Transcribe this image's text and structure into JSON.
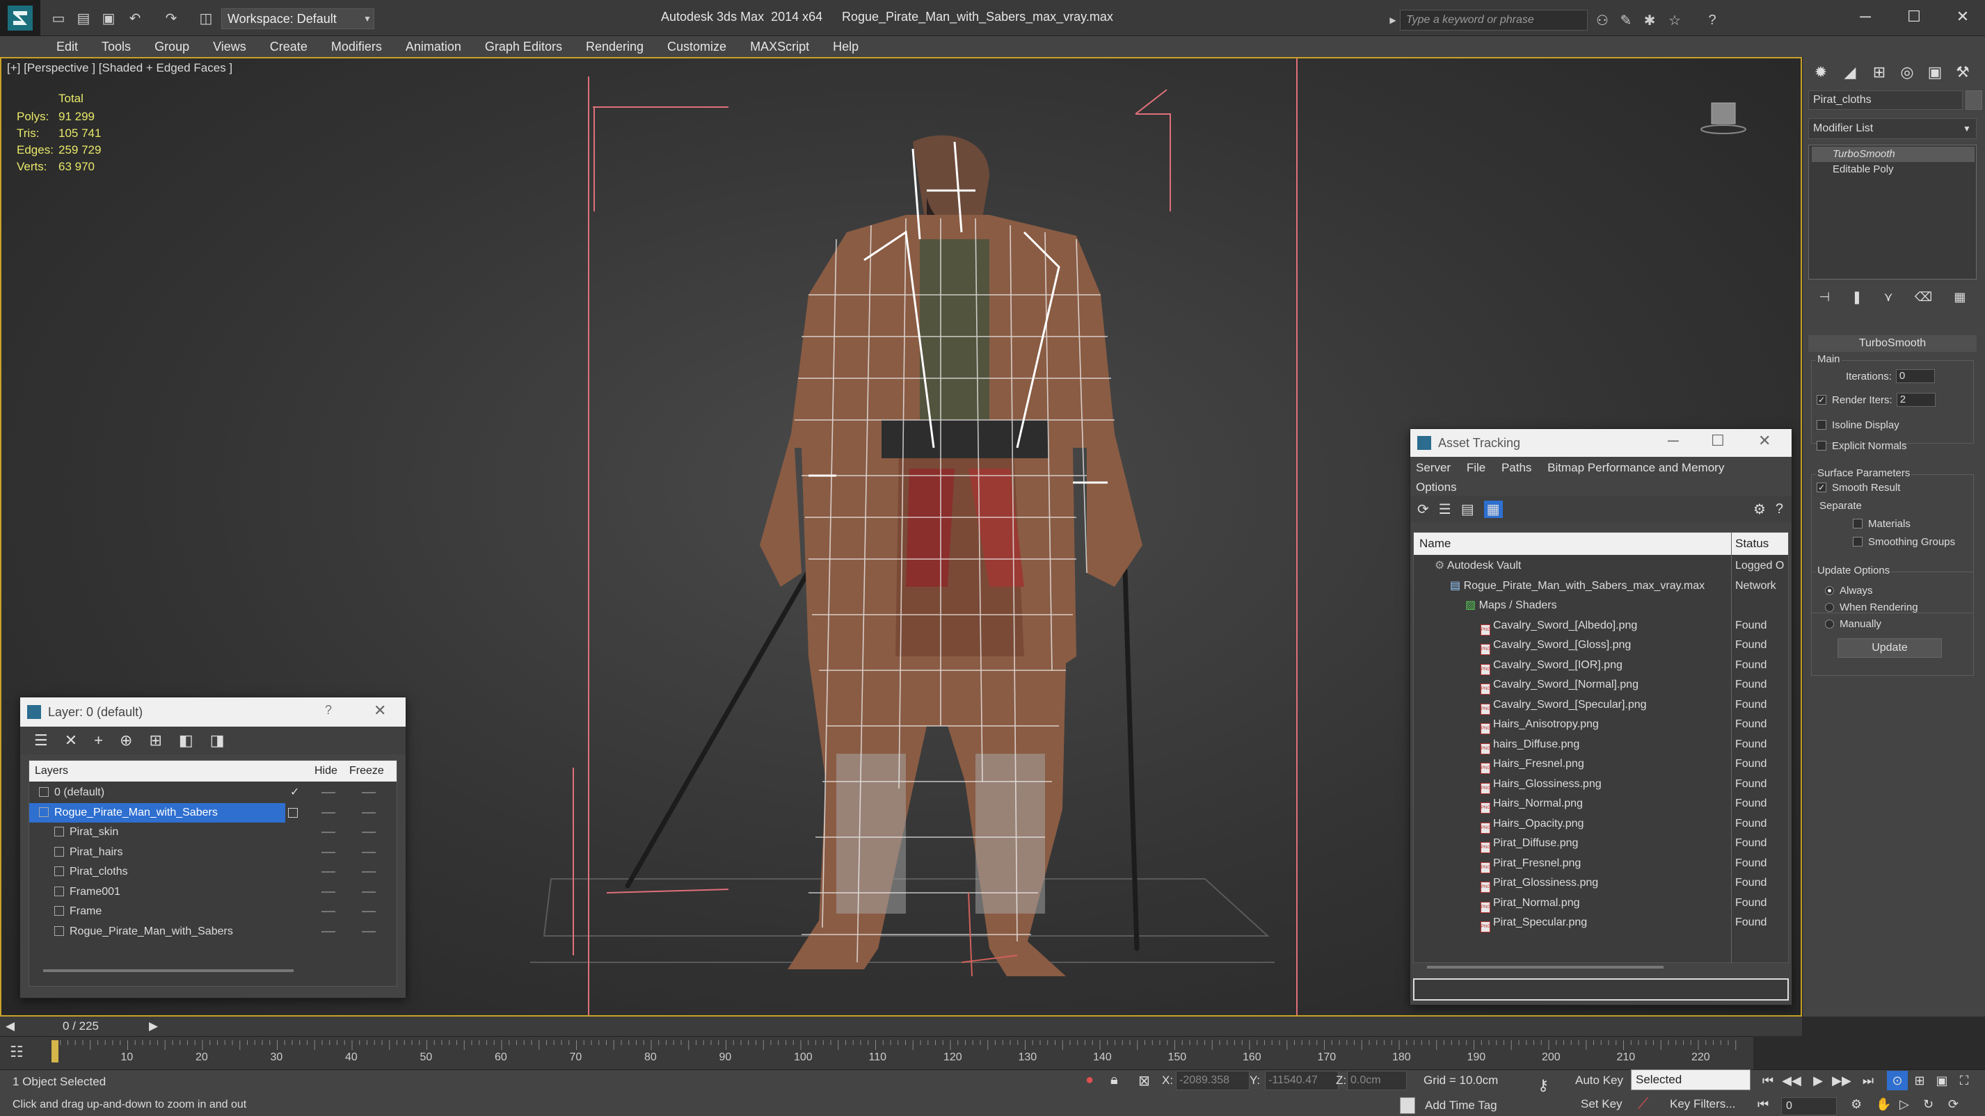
{
  "titlebar": {
    "workspace": "Workspace: Default",
    "app_title": "Autodesk 3ds Max  2014 x64",
    "file_title": "Rogue_Pirate_Man_with_Sabers_max_vray.max",
    "search_placeholder": "Type a keyword or phrase"
  },
  "menu": [
    "Edit",
    "Tools",
    "Group",
    "Views",
    "Create",
    "Modifiers",
    "Animation",
    "Graph Editors",
    "Rendering",
    "Customize",
    "MAXScript",
    "Help"
  ],
  "viewport": {
    "label": "[+] [Perspective ] [Shaded + Edged Faces ]",
    "stats_header": "Total",
    "stats": [
      {
        "label": "Polys:",
        "value": "91 299"
      },
      {
        "label": "Tris:",
        "value": "105 741"
      },
      {
        "label": "Edges:",
        "value": "259 729"
      },
      {
        "label": "Verts:",
        "value": "63 970"
      }
    ]
  },
  "command_panel": {
    "object_name": "Pirat_cloths",
    "modifier_list": "Modifier List",
    "stack": [
      "TurboSmooth",
      "Editable Poly"
    ],
    "rollout_title": "TurboSmooth",
    "main_group": "Main",
    "iterations_label": "Iterations:",
    "iterations_value": "0",
    "render_iters_label": "Render Iters:",
    "render_iters_value": "2",
    "isoline": "Isoline Display",
    "explicit_normals": "Explicit Normals",
    "surface_group": "Surface Parameters",
    "smooth_result": "Smooth Result",
    "separate": "Separate",
    "materials": "Materials",
    "smoothing_groups": "Smoothing Groups",
    "update_group": "Update Options",
    "always": "Always",
    "when_rendering": "When Rendering",
    "manually": "Manually",
    "update_button": "Update"
  },
  "layer_window": {
    "title": "Layer: 0 (default)",
    "help": "?",
    "col_layers": "Layers",
    "col_hide": "Hide",
    "col_freeze": "Freeze",
    "rows": [
      {
        "name": "0 (default)",
        "indent": 1
      },
      {
        "name": "Rogue_Pirate_Man_with_Sabers",
        "indent": 1,
        "selected": true
      },
      {
        "name": "Pirat_skin",
        "indent": 2
      },
      {
        "name": "Pirat_hairs",
        "indent": 2
      },
      {
        "name": "Pirat_cloths",
        "indent": 2
      },
      {
        "name": "Frame001",
        "indent": 2
      },
      {
        "name": "Frame",
        "indent": 2
      },
      {
        "name": "Rogue_Pirate_Man_with_Sabers",
        "indent": 2
      }
    ]
  },
  "asset_window": {
    "title": "Asset Tracking",
    "menu": [
      "Server",
      "File",
      "Paths",
      "Bitmap Performance and Memory",
      "Options"
    ],
    "col_name": "Name",
    "col_status": "Status",
    "rows": [
      {
        "name": "Autodesk Vault",
        "status": "Logged O",
        "indent": 1
      },
      {
        "name": "Rogue_Pirate_Man_with_Sabers_max_vray.max",
        "status": "Network",
        "indent": 2
      },
      {
        "name": "Maps / Shaders",
        "status": "",
        "indent": 3
      },
      {
        "name": "Cavalry_Sword_[Albedo].png",
        "status": "Found",
        "indent": 4
      },
      {
        "name": "Cavalry_Sword_[Gloss].png",
        "status": "Found",
        "indent": 4
      },
      {
        "name": "Cavalry_Sword_[IOR].png",
        "status": "Found",
        "indent": 4
      },
      {
        "name": "Cavalry_Sword_[Normal].png",
        "status": "Found",
        "indent": 4
      },
      {
        "name": "Cavalry_Sword_[Specular].png",
        "status": "Found",
        "indent": 4
      },
      {
        "name": "Hairs_Anisotropy.png",
        "status": "Found",
        "indent": 4
      },
      {
        "name": "hairs_Diffuse.png",
        "status": "Found",
        "indent": 4
      },
      {
        "name": "Hairs_Fresnel.png",
        "status": "Found",
        "indent": 4
      },
      {
        "name": "Hairs_Glossiness.png",
        "status": "Found",
        "indent": 4
      },
      {
        "name": "Hairs_Normal.png",
        "status": "Found",
        "indent": 4
      },
      {
        "name": "Hairs_Opacity.png",
        "status": "Found",
        "indent": 4
      },
      {
        "name": "Pirat_Diffuse.png",
        "status": "Found",
        "indent": 4
      },
      {
        "name": "Pirat_Fresnel.png",
        "status": "Found",
        "indent": 4
      },
      {
        "name": "Pirat_Glossiness.png",
        "status": "Found",
        "indent": 4
      },
      {
        "name": "Pirat_Normal.png",
        "status": "Found",
        "indent": 4
      },
      {
        "name": "Pirat_Specular.png",
        "status": "Found",
        "indent": 4
      }
    ]
  },
  "timeline": {
    "position": "0 / 225",
    "ticks": [
      "10",
      "20",
      "30",
      "40",
      "50",
      "60",
      "70",
      "80",
      "90",
      "100",
      "110",
      "120",
      "130",
      "140",
      "150",
      "160",
      "170",
      "180",
      "190",
      "200",
      "210",
      "220"
    ]
  },
  "status": {
    "selection": "1 Object Selected",
    "hint": "Click and drag up-and-down to zoom in and out",
    "x_label": "X:",
    "x_value": "-2089.358",
    "y_label": "Y:",
    "y_value": "-11540.47",
    "z_label": "Z:",
    "z_value": "0.0cm",
    "grid": "Grid = 10.0cm",
    "auto_key": "Auto Key",
    "selected": "Selected",
    "set_key": "Set Key",
    "key_filters": "Key Filters...",
    "add_time_tag": "Add Time Tag",
    "frame": "0"
  },
  "colors": {
    "accent": "#2e6fd0",
    "viewport_border": "#c9a227",
    "stats_text": "#e8e86a",
    "wireframe": "#f4f4f4"
  }
}
